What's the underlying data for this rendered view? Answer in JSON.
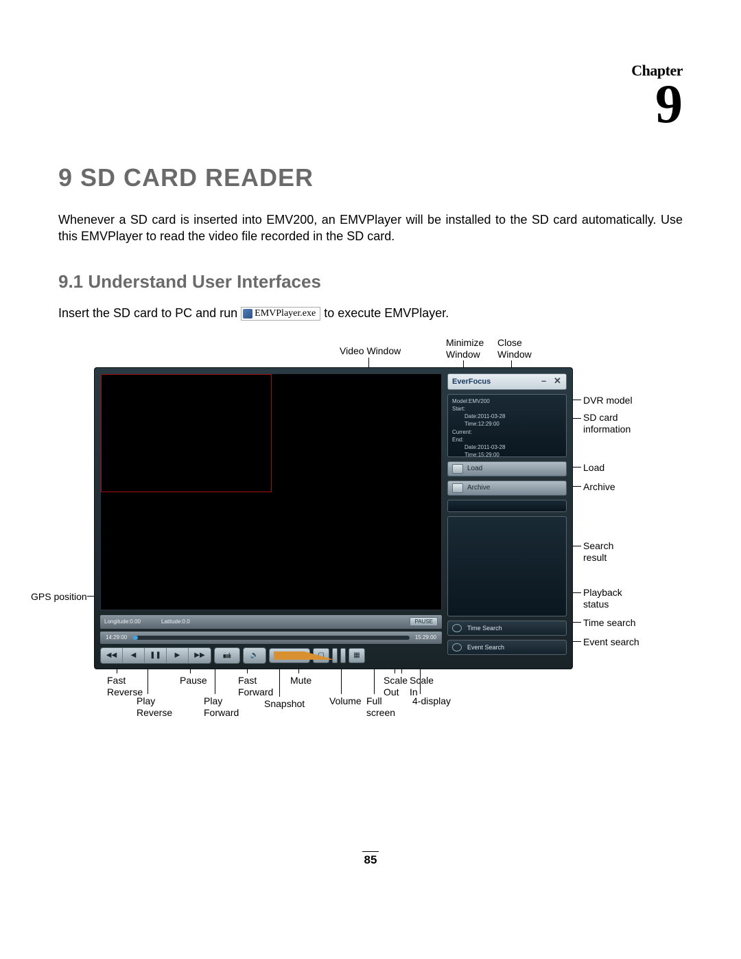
{
  "chapter": {
    "label": "Chapter",
    "number": "9"
  },
  "heading": "9   SD CARD READER",
  "intro": "Whenever a SD card is inserted into EMV200, an EMVPlayer will be installed to the SD card automatically. Use this EMVPlayer to read the video file recorded in the SD card.",
  "subheading": "9.1  Understand User Interfaces",
  "run_line": {
    "before": "Insert the SD card to PC and run",
    "exe": "EMVPlayer.exe",
    "after": "to execute EMVPlayer."
  },
  "labels": {
    "video_window": "Video Window",
    "minimize_window": "Minimize\nWindow",
    "close_window": "Close\nWindow",
    "dvr_model": "DVR model",
    "sd_card_info": "SD card\ninformation",
    "load": "Load",
    "archive": "Archive",
    "search_result": "Search\nresult",
    "playback_status": "Playback\nstatus",
    "time_search": "Time search",
    "event_search": "Event search",
    "gps_position": "GPS position",
    "fast_reverse": "Fast\nReverse",
    "play_reverse": "Play\nReverse",
    "pause": "Pause",
    "play_forward": "Play\nForward",
    "fast_forward": "Fast\nForward",
    "snapshot": "Snapshot",
    "mute": "Mute",
    "volume": "Volume",
    "full_screen": "Full\nscreen",
    "scale_out": "Scale\nOut",
    "scale_in": "Scale\nIn",
    "four_display": "4-display"
  },
  "player": {
    "brand": "EverFocus",
    "info": {
      "model": "Model:EMV200",
      "start_label": "Start:",
      "start_date": "Date:2011-03-28",
      "start_time": "Time:12:29:00",
      "current_label": "Current:",
      "end_label": "End:",
      "end_date": "Date:2011-03-28",
      "end_time": "Time:15:29:00"
    },
    "buttons": {
      "load": "Load",
      "archive": "Archive",
      "time_search": "Time Search",
      "event_search": "Event Search"
    },
    "gps": {
      "longitude": "Longitude:0.00",
      "latitude": "Latitude:0.0",
      "pause": "PAUSE"
    },
    "timeline": {
      "start": "14:29:00",
      "end": "15:29:00"
    }
  },
  "page_number": "85"
}
